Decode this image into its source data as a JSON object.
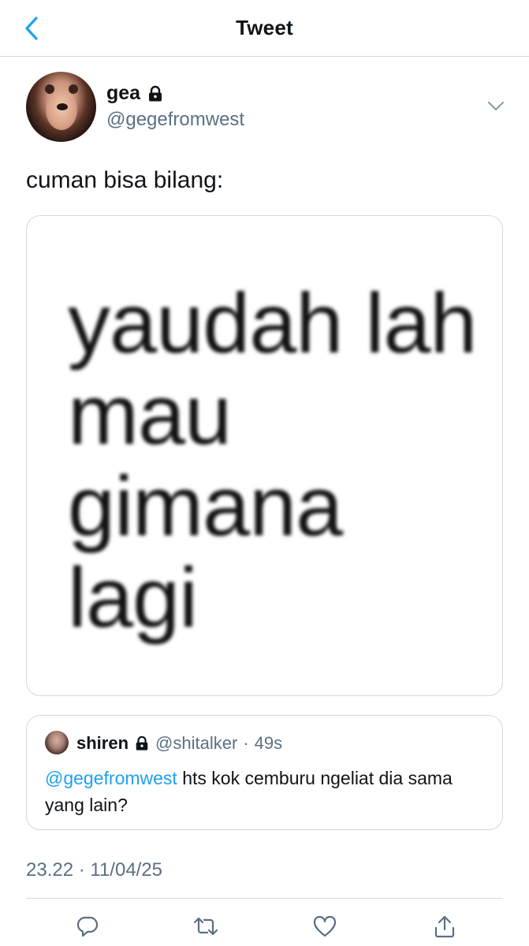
{
  "header": {
    "title": "Tweet",
    "back_icon": "chevron-left-icon",
    "accent": "#1da1f2"
  },
  "tweet": {
    "author": {
      "name": "gea",
      "handle": "@gegefromwest",
      "protected": true
    },
    "text": "cuman bisa bilang:",
    "media": {
      "lines": [
        "yaudah lah",
        "mau",
        "gimana",
        "lagi"
      ]
    },
    "quoted": {
      "name": "shiren",
      "handle": "@shitalker",
      "separator": "·",
      "time": "49s",
      "mention": "@gegefromwest",
      "text_rest": " hts kok cemburu ngeliat dia sama yang lain?"
    },
    "timestamp": "23.22 · 11/04/25"
  },
  "actions": [
    {
      "name": "reply",
      "icon": "reply-icon"
    },
    {
      "name": "retweet",
      "icon": "retweet-icon"
    },
    {
      "name": "like",
      "icon": "heart-icon"
    },
    {
      "name": "share",
      "icon": "share-icon"
    }
  ],
  "colors": {
    "text": "#0f1419",
    "secondary": "#5b7083",
    "link": "#1da1f2",
    "border": "#d5d9dd"
  }
}
